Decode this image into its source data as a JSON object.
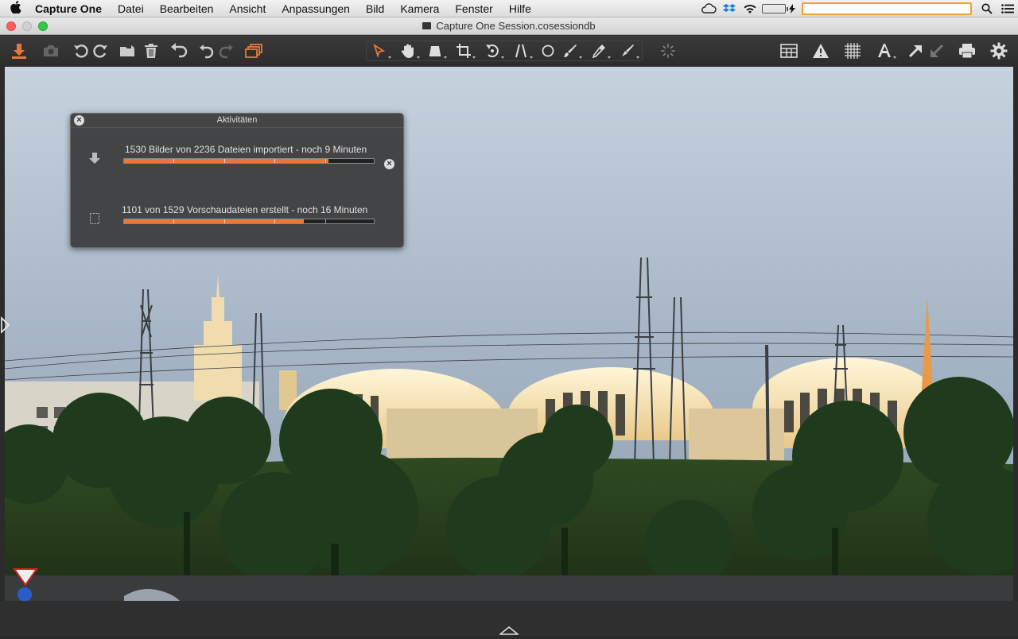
{
  "menubar": {
    "app_name": "Capture One",
    "items": [
      "Datei",
      "Bearbeiten",
      "Ansicht",
      "Anpassungen",
      "Bild",
      "Kamera",
      "Fenster",
      "Hilfe"
    ],
    "battery_level": 1.0
  },
  "window": {
    "title": "Capture One Session.cosessiondb"
  },
  "toolbar": {
    "left_icons": [
      "import-icon",
      "camera-icon",
      "rotate-left-icon",
      "rotate-right-icon",
      "folder-icon",
      "trash-icon",
      "undo-all-icon",
      "undo-icon",
      "redo-icon",
      "stacks-icon"
    ],
    "tools": [
      "select-cursor-icon",
      "pan-hand-icon",
      "loupe-icon",
      "crop-icon",
      "rotate-tool-icon",
      "keystone-icon",
      "spot-icon",
      "brush-icon",
      "color-picker-icon",
      "eraser-icon"
    ],
    "right_icons": [
      "loading-spinner-icon",
      "grid-view-icon",
      "exposure-warning-icon",
      "grid-overlay-icon",
      "text-icon",
      "export-arrow-icon",
      "process-arrow-icon",
      "print-icon",
      "settings-gear-icon"
    ]
  },
  "activities": {
    "title": "Aktivitäten",
    "tasks": [
      {
        "label": "1530 Bilder von 2236 Dateien importiert - noch 9 Minuten",
        "progress": 0.82,
        "icon": "download-arrow-icon",
        "cancel_label": "×"
      },
      {
        "label": "1101 von 1529 Vorschaudateien erstellt - noch 16 Minuten",
        "progress": 0.72,
        "icon": "preview-frame-icon"
      }
    ],
    "close_label": "×"
  },
  "colors": {
    "accent": "#e8783a",
    "toolbar_bg": "#2f2f2f",
    "search_border": "#f0a030"
  }
}
